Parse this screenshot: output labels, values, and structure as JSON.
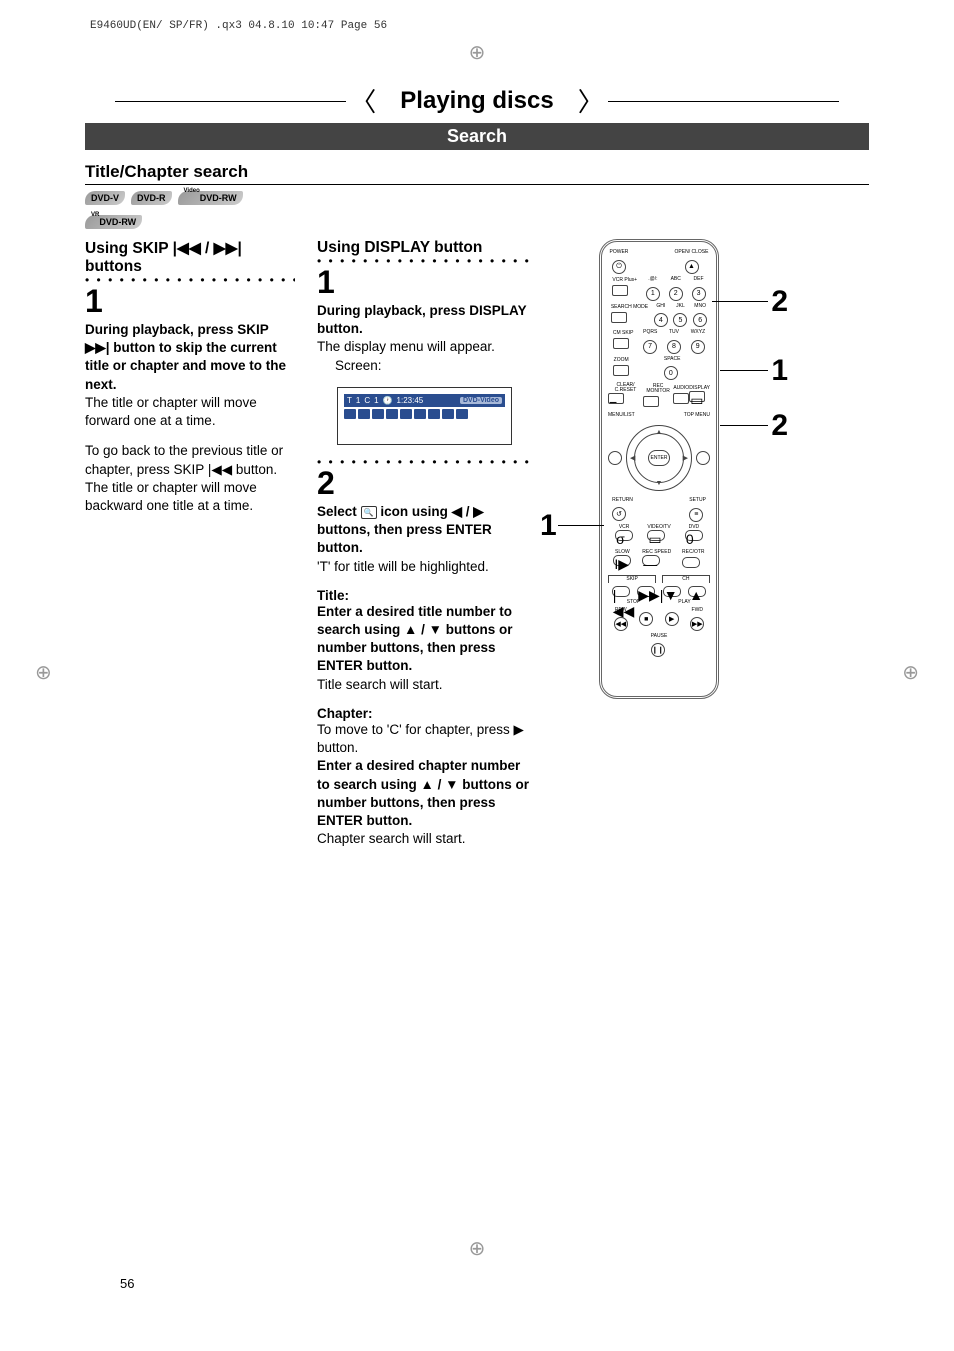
{
  "meta": {
    "header_line": "E9460UD(EN/ SP/FR) .qx3  04.8.10  10:47  Page 56"
  },
  "title_banner": "Playing discs",
  "sub_banner": "Search",
  "section_title": "Title/Chapter search",
  "badges": {
    "dvd_v": "DVD-V",
    "dvd_r": "DVD-R",
    "dvd_rw_video": "DVD-RW",
    "dvd_rw_video_sup": "Video",
    "dvd_rw_vr": "DVD-RW",
    "dvd_rw_vr_sup": "VR"
  },
  "left": {
    "method_title": "Using SKIP |◀◀ / ▶▶| buttons",
    "step1_num": "1",
    "p1_bold": "During playback, press SKIP ▶▶| button to skip the current title or chapter and move to the next.",
    "p1_reg": "The title or chapter will move forward one at a time.",
    "p2_reg": "To go back to the previous title or chapter, press SKIP |◀◀ button. The title or chapter will move backward one title at a time."
  },
  "mid": {
    "method_title": "Using DISPLAY button",
    "step1_num": "1",
    "p1_bold": "During playback, press DISPLAY button.",
    "p1_reg": "The display menu will appear.",
    "screen_label": "Screen:",
    "screen_bar": {
      "t": "T",
      "t_val": "1",
      "c": "C",
      "c_val": "1",
      "clock_icon": "🕐",
      "time": "1:23:45",
      "pill": "DVD-Video"
    },
    "step2_num": "2",
    "p2_bold_a": "Select ",
    "p2_icon": "🔍",
    "p2_bold_b": " icon using ◀ / ▶ buttons, then press ENTER button.",
    "p2_reg": "'T' for title will be highlighted.",
    "title_h": "Title:",
    "title_bold": "Enter a desired title number to search using ▲ / ▼ buttons or number buttons, then press ENTER button.",
    "title_reg": "Title search will start.",
    "chapter_h": "Chapter:",
    "chapter_reg1": "To move to 'C' for chapter, press ▶ button.",
    "chapter_bold": "Enter a desired chapter number to search using ▲ / ▼ but­tons or number buttons, then press ENTER button.",
    "chapter_reg2": "Chapter search will start."
  },
  "callouts": {
    "c1": "1",
    "c2a": "2",
    "c2b": "2",
    "c_left1": "1"
  },
  "remote": {
    "power": "POWER",
    "open_close": "OPEN/\nCLOSE",
    "eject": "▲",
    "vcr_plus": "VCR Plus+",
    "abc": "ABC",
    "def": "DEF",
    "ghi": "GHI",
    "jkl": "JKL",
    "mno": "MNO",
    "pqrs": "PQRS",
    "tuv": "TUV",
    "wxyz": "WXYZ",
    "n_at": ".@/:",
    "n1": "1",
    "n2": "2",
    "n3": "3",
    "n4": "4",
    "n5": "5",
    "n6": "6",
    "n7": "7",
    "n8": "8",
    "n9": "9",
    "n0": "0",
    "search_mode": "SEARCH\nMODE",
    "cm_skip": "CM SKIP",
    "zoom": "ZOOM",
    "space": "SPACE",
    "clear_creset": "CLEAR/\nC.RESET",
    "rec_monitor": "REC\nMONITOR",
    "audio": "AUDIO",
    "display": "DISPLAY",
    "menu_list": "MENU/LIST",
    "top_menu": "TOP MENU",
    "enter": "ENTER",
    "return": "RETURN",
    "setup": "SETUP",
    "vcr": "VCR",
    "video_tv": "VIDEO/TV",
    "dvd": "DVD",
    "select_sigma": "σ",
    "tv_icon": "▭",
    "zero_btn": "0",
    "slow": "SLOW",
    "rec_speed": "REC\nSPEED",
    "rec_otr": "REC/OTR",
    "skip": "SKIP",
    "ch": "CH",
    "skip_prev": "|◀◀",
    "skip_next": "▶▶|",
    "ch_down": "▼",
    "ch_up": "▲",
    "stop": "STOP",
    "play": "PLAY",
    "rew": "REW",
    "stop_sym": "■",
    "play_sym": "▶",
    "fwd": "FWD",
    "rew_sym": "◀◀",
    "fwd_sym": "▶▶",
    "pause": "PAUSE",
    "pause_sym": "❙❙"
  },
  "page_number": "56"
}
